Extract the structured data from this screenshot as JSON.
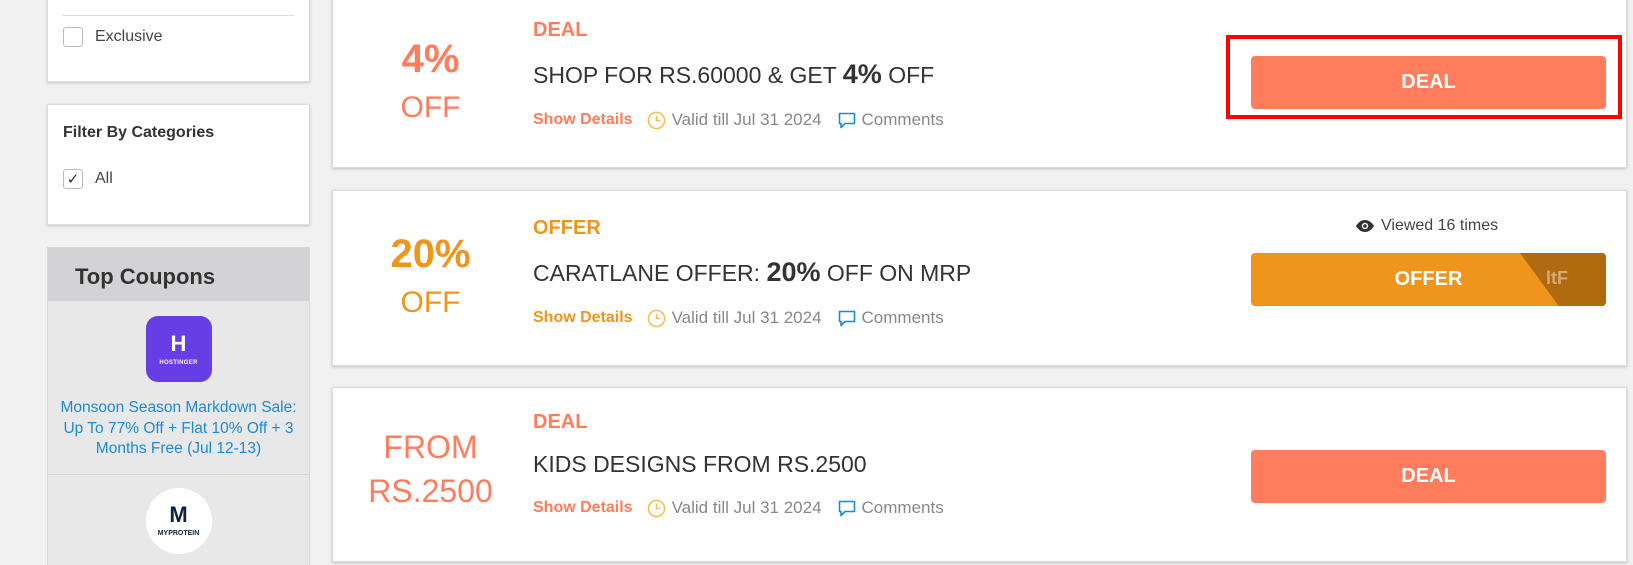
{
  "sidebar": {
    "exclusive_label": "Exclusive",
    "filter_title": "Filter By Categories",
    "all_label": "All",
    "all_checked": true,
    "top_coupons_title": "Top Coupons",
    "top_items": [
      {
        "logo_mark": "H",
        "logo_text": "HOSTINGER",
        "text": "Monsoon Season Markdown Sale: Up To 77% Off + Flat 10% Off + 3 Months Free (Jul 12-13)"
      },
      {
        "logo_mark": "M",
        "logo_text": "MYPROTEIN",
        "text": ""
      }
    ]
  },
  "coupons": [
    {
      "badge_big": "4%",
      "badge_small": "OFF",
      "type": "DEAL",
      "title_pre": "SHOP FOR RS.60000 & GET ",
      "title_bold": "4%",
      "title_post": " OFF",
      "show_details": "Show Details",
      "valid": "Valid till Jul 31 2024",
      "comments": "Comments",
      "button": "DEAL"
    },
    {
      "badge_big": "20%",
      "badge_small": "OFF",
      "type": "OFFER",
      "title_pre": "CARATLANE OFFER: ",
      "title_bold": "20%",
      "title_post": " OFF ON MRP",
      "show_details": "Show Details",
      "valid": "Valid till Jul 31 2024",
      "comments": "Comments",
      "viewed": "Viewed 16 times",
      "button": "OFFER",
      "peel_code": "ltF"
    },
    {
      "badge_big": "FROM",
      "badge_small": "RS.2500",
      "type": "DEAL",
      "title_pre": "KIDS DESIGNS FROM RS.2500",
      "show_details": "Show Details",
      "valid": "Valid till Jul 31 2024",
      "comments": "Comments",
      "button": "DEAL"
    }
  ],
  "colors": {
    "deal": "#ff7c5c",
    "offer": "#f0951b",
    "highlight": "#ff0000",
    "link": "#1b8ad6"
  },
  "icons": [
    "clock-icon",
    "comment-icon",
    "eye-icon",
    "checkmark-icon"
  ]
}
